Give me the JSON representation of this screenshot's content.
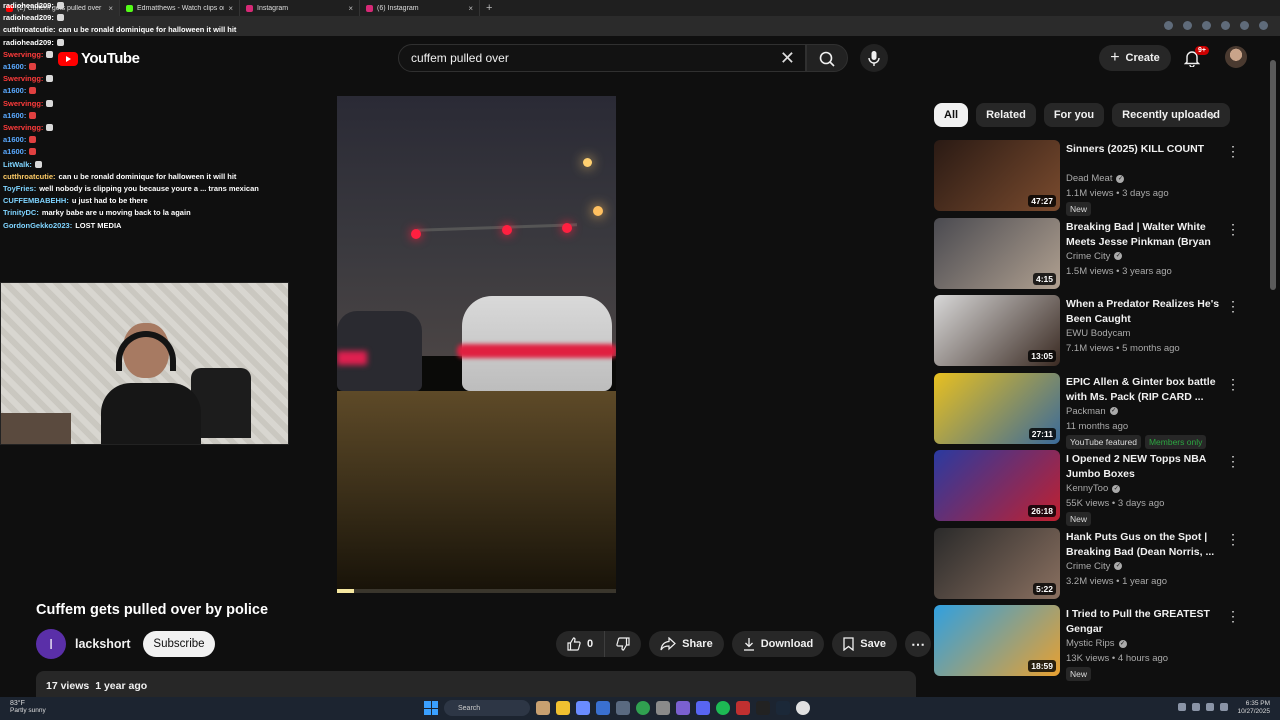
{
  "browser": {
    "tabs": [
      {
        "title": "(2) Cuffem gets pulled over",
        "favicon_color": "#ff0000",
        "active": true
      },
      {
        "title": "Edmatthews - Watch clips on Kick",
        "favicon_color": "#53fc18",
        "active": false
      },
      {
        "title": "Instagram",
        "favicon_color": "#d62976",
        "active": false
      },
      {
        "title": "(6) Instagram",
        "favicon_color": "#d62976",
        "active": false
      }
    ]
  },
  "chat": [
    {
      "user": "radiohead209:",
      "user_color": "#ffffff",
      "text": ""
    },
    {
      "user": "radiohead209:",
      "user_color": "#ffffff",
      "text": ""
    },
    {
      "user": "cutthroatcutie:",
      "user_color": "#ffffff",
      "text": "can u be ronald dominique for halloween it will hit"
    },
    {
      "user": "radiohead209:",
      "user_color": "#ffffff",
      "text": ""
    },
    {
      "user": "Swervingg:",
      "user_color": "#ff3b3b",
      "text": ""
    },
    {
      "user": "a1600:",
      "user_color": "#5aa9ff",
      "text": ""
    },
    {
      "user": "Swervingg:",
      "user_color": "#ff3b3b",
      "text": ""
    },
    {
      "user": "a1600:",
      "user_color": "#5aa9ff",
      "text": ""
    },
    {
      "user": "Swervingg:",
      "user_color": "#ff3b3b",
      "text": ""
    },
    {
      "user": "a1600:",
      "user_color": "#5aa9ff",
      "text": ""
    },
    {
      "user": "Swervingg:",
      "user_color": "#ff3b3b",
      "text": ""
    },
    {
      "user": "a1600:",
      "user_color": "#5aa9ff",
      "text": ""
    },
    {
      "user": "a1600:",
      "user_color": "#5aa9ff",
      "text": ""
    },
    {
      "user": "LitWalk:",
      "user_color": "#7fd4ff",
      "text": ""
    },
    {
      "user": "cutthroatcutie:",
      "user_color": "#ffcc66",
      "text": "can u be ronald dominique for halloween it will hit"
    },
    {
      "user": "ToyFries:",
      "user_color": "#7fd4ff",
      "text": "well nobody is clipping you because youre a ... trans mexican"
    },
    {
      "user": "CUFFEMBABEHH:",
      "user_color": "#7fd4ff",
      "text": "u just had to be there"
    },
    {
      "user": "TrinityDC:",
      "user_color": "#7fd4ff",
      "text": "marky babe are u moving back to la again"
    },
    {
      "user": "GordonGekko2023:",
      "user_color": "#7fd4ff",
      "text": "LOST MEDIA"
    }
  ],
  "header": {
    "logo_text": "YouTube",
    "search_value": "cuffem pulled over",
    "clear_icon": "close-icon",
    "create_label": "Create",
    "notification_count": "9+"
  },
  "video": {
    "title": "Cuffem gets pulled over by police",
    "channel_initial": "l",
    "channel_name": "lackshort",
    "subscribe_label": "Subscribe",
    "like_count": "0",
    "share_label": "Share",
    "download_label": "Download",
    "save_label": "Save",
    "more_label": "⋯",
    "views": "17 views",
    "age": "1 year ago",
    "progress_fraction": 0.06
  },
  "chips": [
    "All",
    "Related",
    "For you",
    "Recently uploaded"
  ],
  "recommendations": [
    {
      "title": "Sinners (2025) KILL COUNT",
      "channel": "Dead Meat",
      "verified": true,
      "meta": "1.1M views • 3 days ago",
      "duration": "47:27",
      "tags": [
        "New"
      ],
      "thumb": [
        "#2a1a14",
        "#7a4b2e"
      ]
    },
    {
      "title": "Breaking Bad | Walter White Meets Jesse Pinkman (Bryan ...",
      "channel": "Crime City",
      "verified": true,
      "meta": "1.5M views • 3 years ago",
      "duration": "4:15",
      "tags": [],
      "thumb": [
        "#4a4a50",
        "#b0a090"
      ]
    },
    {
      "title": "When a Predator Realizes He's Been Caught",
      "channel": "EWU Bodycam",
      "verified": false,
      "meta": "7.1M views • 5 months ago",
      "duration": "13:05",
      "tags": [],
      "thumb": [
        "#d8d8d8",
        "#3a2a22"
      ]
    },
    {
      "title": "EPIC Allen & Ginter box battle with Ms. Pack (RIP CARD ...",
      "channel": "Packman",
      "verified": true,
      "meta": "11 months ago",
      "duration": "27:11",
      "tags": [
        "YouTube featured",
        "Members only"
      ],
      "thumb": [
        "#e8c020",
        "#3a6a9a"
      ]
    },
    {
      "title": "I Opened 2 NEW Topps NBA Jumbo Boxes",
      "channel": "KennyToo",
      "verified": true,
      "meta": "55K views • 3 days ago",
      "duration": "26:18",
      "tags": [
        "New"
      ],
      "thumb": [
        "#2a3aa0",
        "#c02030"
      ]
    },
    {
      "title": "Hank Puts Gus on the Spot | Breaking Bad (Dean Norris, ...",
      "channel": "Crime City",
      "verified": true,
      "meta": "3.2M views • 1 year ago",
      "duration": "5:22",
      "tags": [],
      "thumb": [
        "#2a2a2a",
        "#8a7060"
      ]
    },
    {
      "title": "I Tried to Pull the GREATEST Gengar",
      "channel": "Mystic Rips",
      "verified": true,
      "meta": "13K views • 4 hours ago",
      "duration": "18:59",
      "tags": [
        "New"
      ],
      "thumb": [
        "#30a0e0",
        "#e8a030"
      ]
    }
  ],
  "taskbar": {
    "weather_temp": "83°F",
    "weather_desc": "Partly sunny",
    "search_placeholder": "Search",
    "time": "6:35 PM",
    "date": "10/27/2025"
  }
}
